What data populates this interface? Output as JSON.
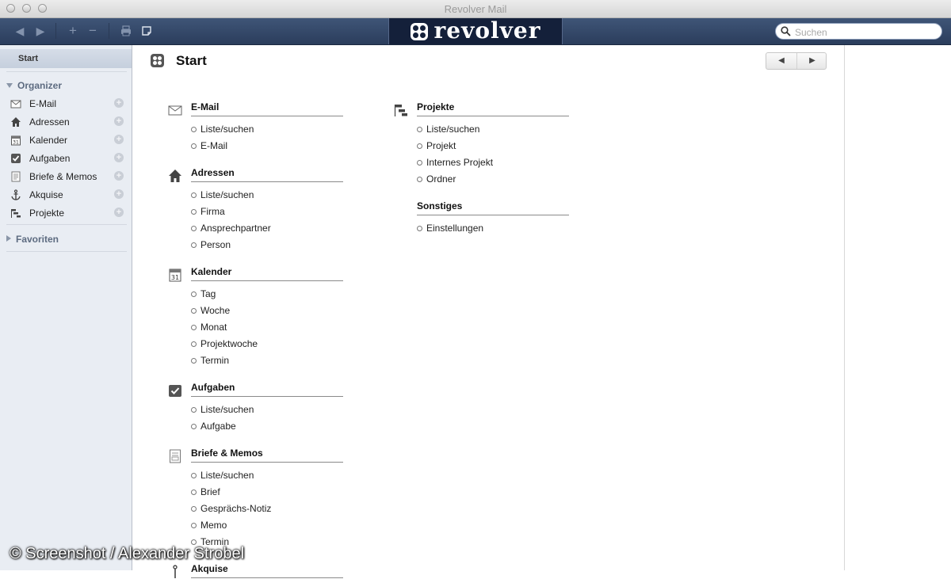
{
  "window": {
    "title": "Revolver Mail"
  },
  "toolbar": {
    "back": "◀",
    "forward": "▶",
    "add": "+",
    "remove": "−",
    "logo_text": "revolver",
    "search_placeholder": "Suchen"
  },
  "sidebar": {
    "start_label": "Start",
    "organizer_label": "Organizer",
    "favoriten_label": "Favoriten",
    "items": [
      {
        "label": "E-Mail",
        "icon": "envelope-icon"
      },
      {
        "label": "Adressen",
        "icon": "house-icon"
      },
      {
        "label": "Kalender",
        "icon": "calendar-icon"
      },
      {
        "label": "Aufgaben",
        "icon": "checkbox-icon"
      },
      {
        "label": "Briefe & Memos",
        "icon": "document-icon"
      },
      {
        "label": "Akquise",
        "icon": "anchor-icon"
      },
      {
        "label": "Projekte",
        "icon": "project-icon"
      }
    ]
  },
  "main": {
    "title": "Start",
    "nav_prev": "◀",
    "nav_next": "▶",
    "groups_left": [
      {
        "title": "E-Mail",
        "items": [
          "Liste/suchen",
          "E-Mail"
        ]
      },
      {
        "title": "Adressen",
        "items": [
          "Liste/suchen",
          "Firma",
          "Ansprechpartner",
          "Person"
        ]
      },
      {
        "title": "Kalender",
        "items": [
          "Tag",
          "Woche",
          "Monat",
          "Projektwoche",
          "Termin"
        ]
      },
      {
        "title": "Aufgaben",
        "items": [
          "Liste/suchen",
          "Aufgabe"
        ]
      },
      {
        "title": "Briefe & Memos",
        "items": [
          "Liste/suchen",
          "Brief",
          "Gesprächs-Notiz",
          "Memo",
          "Termin"
        ]
      },
      {
        "title": "Akquise",
        "items": []
      }
    ],
    "groups_right": [
      {
        "title": "Projekte",
        "items": [
          "Liste/suchen",
          "Projekt",
          "Internes Projekt",
          "Ordner"
        ]
      },
      {
        "title": "Sonstiges",
        "items": [
          "Einstellungen"
        ]
      }
    ]
  },
  "watermark": "© Screenshot / Alexander Strobel"
}
